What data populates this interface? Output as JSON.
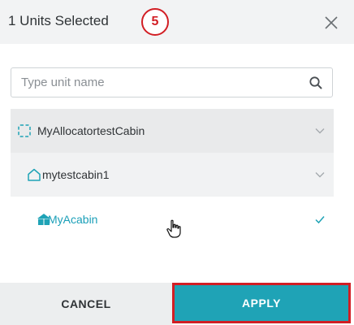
{
  "header": {
    "title": "1 Units Selected",
    "step_number": "5",
    "close_icon": "close-icon"
  },
  "search": {
    "placeholder": "Type unit name",
    "value": "",
    "icon": "search-icon"
  },
  "tree": {
    "items": [
      {
        "label": "MyAllocatortestCabin",
        "icon": "dashed-square-icon",
        "indicator": "chevron-down-icon"
      },
      {
        "label": "mytestcabin1",
        "icon": "house-outline-icon",
        "indicator": "chevron-down-icon"
      },
      {
        "label": "MyAcabin",
        "icon": "unit-grid-icon",
        "indicator": "check-icon",
        "selected": true
      }
    ]
  },
  "footer": {
    "cancel_label": "CANCEL",
    "apply_label": "APPLY"
  },
  "colors": {
    "accent": "#1fa3b6",
    "selected_text": "#1a9fb8",
    "highlight": "#d21e24",
    "header_bg": "#f2f3f4"
  }
}
